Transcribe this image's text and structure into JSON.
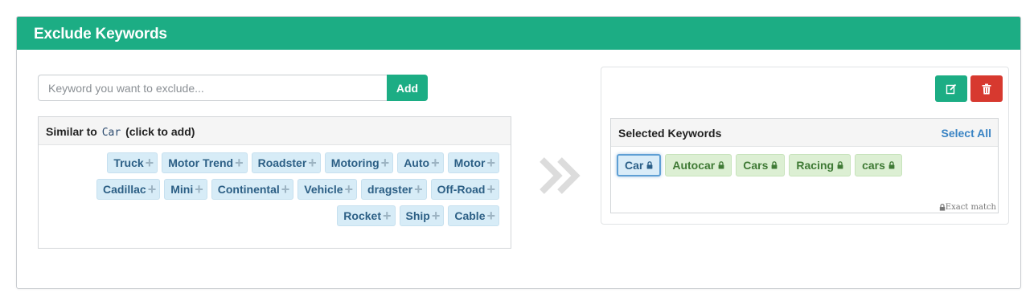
{
  "header": {
    "title": "Exclude Keywords"
  },
  "input": {
    "placeholder": "Keyword you want to exclude...",
    "value": ""
  },
  "add_button": {
    "label": "Add"
  },
  "similar": {
    "prefix": "Similar to",
    "keyword": "Car",
    "suffix": "(click to add)",
    "suggestions": [
      "Truck",
      "Motor Trend",
      "Roadster",
      "Motoring",
      "Auto",
      "Motor",
      "Cadillac",
      "Mini",
      "Continental",
      "Vehicle",
      "dragster",
      "Off-Road",
      "Rocket",
      "Ship",
      "Cable"
    ]
  },
  "selected": {
    "title": "Selected Keywords",
    "select_all": "Select All",
    "exact_match_label": "Exact match",
    "chips": [
      {
        "label": "Car",
        "state": "active"
      },
      {
        "label": "Autocar",
        "state": "normal"
      },
      {
        "label": "Cars",
        "state": "normal"
      },
      {
        "label": "Racing",
        "state": "normal"
      },
      {
        "label": "cars",
        "state": "normal"
      }
    ]
  },
  "icons": {
    "suggestion_add": "plus-icon",
    "chip": "lock-icon",
    "arrow": "double-chevron-right-icon",
    "edit": "edit-icon",
    "delete": "trash-icon"
  },
  "colors": {
    "accent": "#1cad84",
    "danger": "#d7392f",
    "link": "#3a84c4"
  }
}
